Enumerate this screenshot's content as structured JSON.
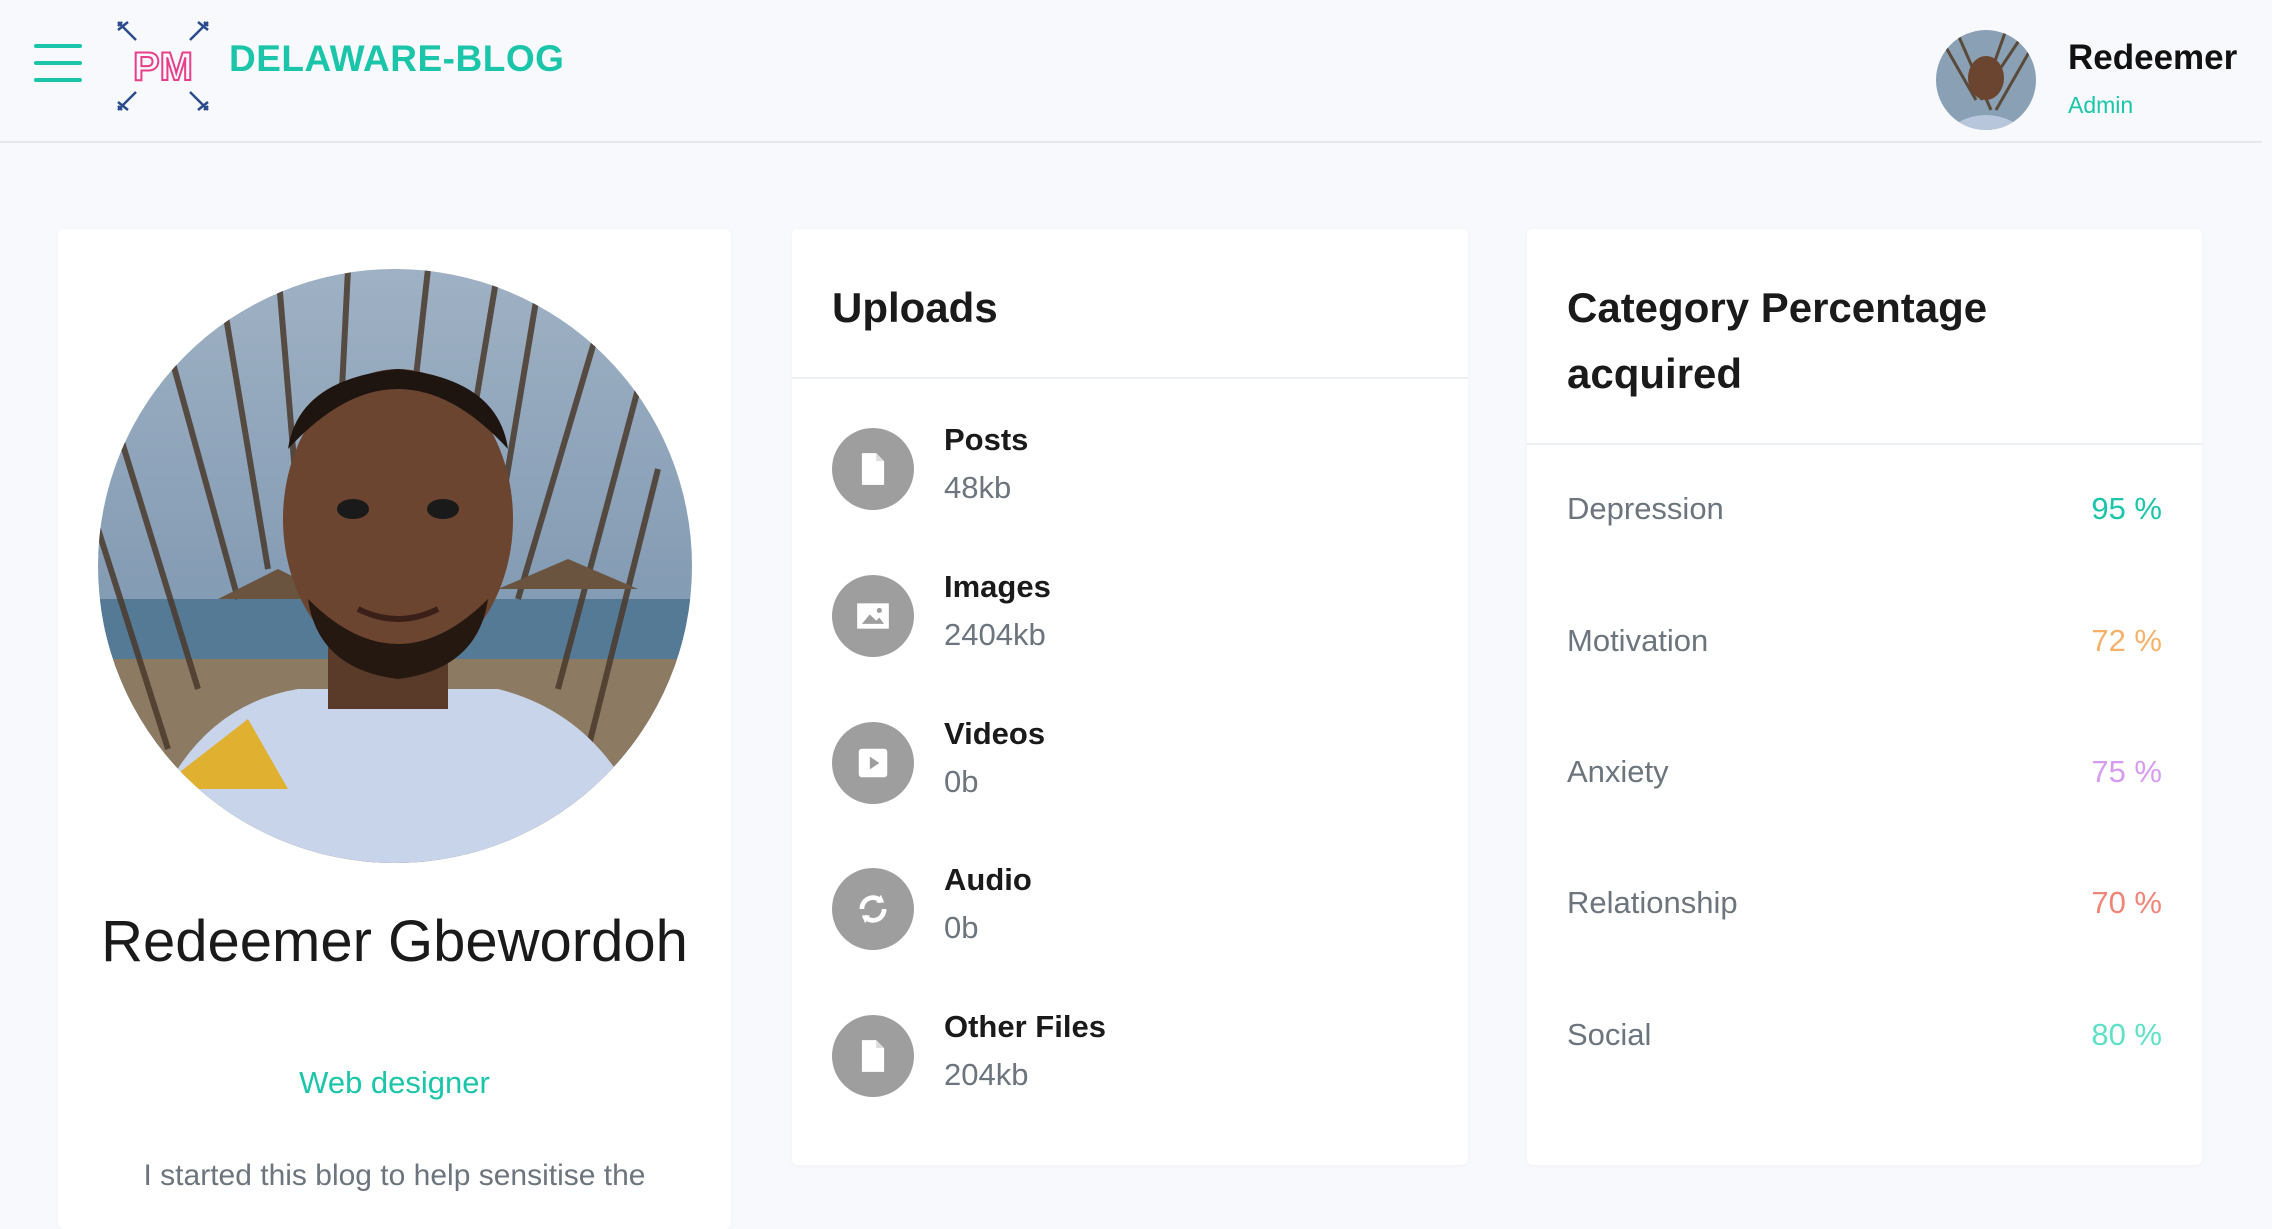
{
  "header": {
    "brand": "DELAWARE-BLOG",
    "logo_text": "PM",
    "user_name": "Redeemer",
    "user_role": "Admin"
  },
  "profile": {
    "name": "Redeemer Gbewordoh",
    "title": "Web designer",
    "bio": "I started this blog to help sensitise the"
  },
  "uploads": {
    "title": "Uploads",
    "items": [
      {
        "label": "Posts",
        "size": "48kb",
        "icon": "file-icon"
      },
      {
        "label": "Images",
        "size": "2404kb",
        "icon": "image-icon"
      },
      {
        "label": "Videos",
        "size": "0b",
        "icon": "video-icon"
      },
      {
        "label": "Audio",
        "size": "0b",
        "icon": "audio-icon"
      },
      {
        "label": "Other Files",
        "size": "204kb",
        "icon": "file-icon"
      }
    ]
  },
  "category": {
    "title": "Category Percentage acquired",
    "items": [
      {
        "name": "Depression",
        "percent": "95 %",
        "color": "#1bc5a9"
      },
      {
        "name": "Motivation",
        "percent": "72 %",
        "color": "#f5b16a"
      },
      {
        "name": "Anxiety",
        "percent": "75 %",
        "color": "#d69cf0"
      },
      {
        "name": "Relationship",
        "percent": "70 %",
        "color": "#f08577"
      },
      {
        "name": "Social",
        "percent": "80 %",
        "color": "#5fe0c7"
      }
    ]
  },
  "colors": {
    "accent": "#1bc5a9",
    "logo_pink": "#e83e8c",
    "icon_gray": "#9e9e9e"
  }
}
